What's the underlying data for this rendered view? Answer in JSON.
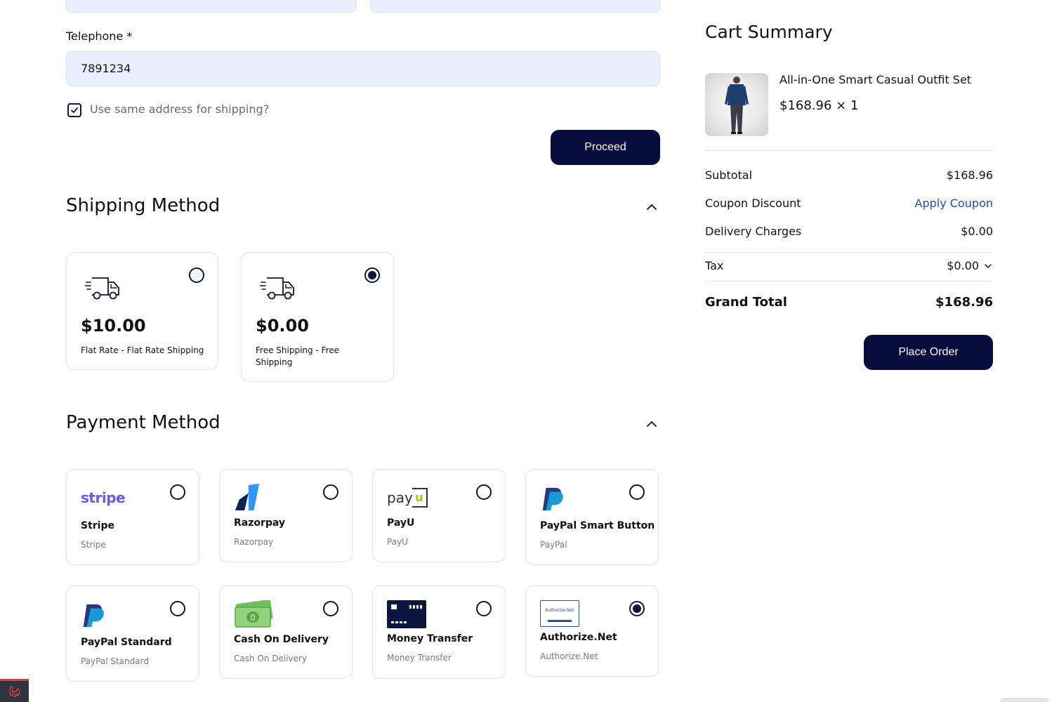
{
  "form": {
    "telephone_label": "Telephone *",
    "telephone_value": "7891234",
    "same_address_label": "Use same address for shipping?",
    "proceed_label": "Proceed"
  },
  "shipping": {
    "title": "Shipping Method",
    "options": [
      {
        "price": "$10.00",
        "desc": "Flat Rate - Flat Rate Shipping",
        "selected": false,
        "icon": "truck-icon"
      },
      {
        "price": "$0.00",
        "desc": "Free Shipping - Free Shipping",
        "selected": true,
        "icon": "truck-icon"
      }
    ]
  },
  "payment": {
    "title": "Payment Method",
    "options": [
      {
        "title": "Stripe",
        "sub": "Stripe",
        "logo_text": "stripe",
        "selected": false
      },
      {
        "title": "Razorpay",
        "sub": "Razorpay",
        "selected": false
      },
      {
        "title": "PayU",
        "sub": "PayU",
        "logo_text": "payu",
        "selected": false
      },
      {
        "title": "PayPal Smart Button",
        "sub": "PayPal",
        "selected": false
      },
      {
        "title": "PayPal Standard",
        "sub": "PayPal Standard",
        "selected": false
      },
      {
        "title": "Cash On Delivery",
        "sub": "Cash On Delivery",
        "selected": false
      },
      {
        "title": "Money Transfer",
        "sub": "Money Transfer",
        "selected": false
      },
      {
        "title": "Authorize.Net",
        "sub": "Authorize.Net",
        "logo_text": "Authorize.Net",
        "selected": true
      }
    ]
  },
  "cart": {
    "title": "Cart Summary",
    "item_name": "All-in-One Smart Casual Outfit Set",
    "item_price": "$168.96 × 1",
    "subtotal_label": "Subtotal",
    "subtotal_value": "$168.96",
    "coupon_label": "Coupon Discount",
    "coupon_link": "Apply Coupon",
    "delivery_label": "Delivery Charges",
    "delivery_value": "$0.00",
    "tax_label": "Tax",
    "tax_value": "$0.00",
    "grand_label": "Grand Total",
    "grand_value": "$168.96",
    "place_order_label": "Place Order"
  },
  "colors": {
    "primary": "#060c3b",
    "input_bg": "#e8effd",
    "link": "#1d4ed8",
    "stripe": "#635bff",
    "payu_green": "#a6c307"
  }
}
